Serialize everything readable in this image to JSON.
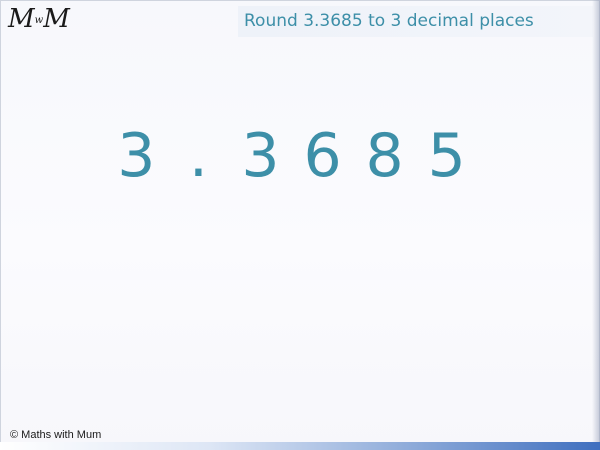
{
  "logo": {
    "letter_left": "M",
    "letter_middle": "w",
    "letter_right": "M"
  },
  "title": "Round 3.3685 to 3 decimal places",
  "number": {
    "chars": [
      "3",
      ".",
      "3",
      "6",
      "8",
      "5"
    ]
  },
  "footer": "© Maths with Mum",
  "colors": {
    "accent_text": "#3d8fa8",
    "title_bg": "#eef2f9",
    "bottom_bar_blue": "#3f6fbf"
  }
}
